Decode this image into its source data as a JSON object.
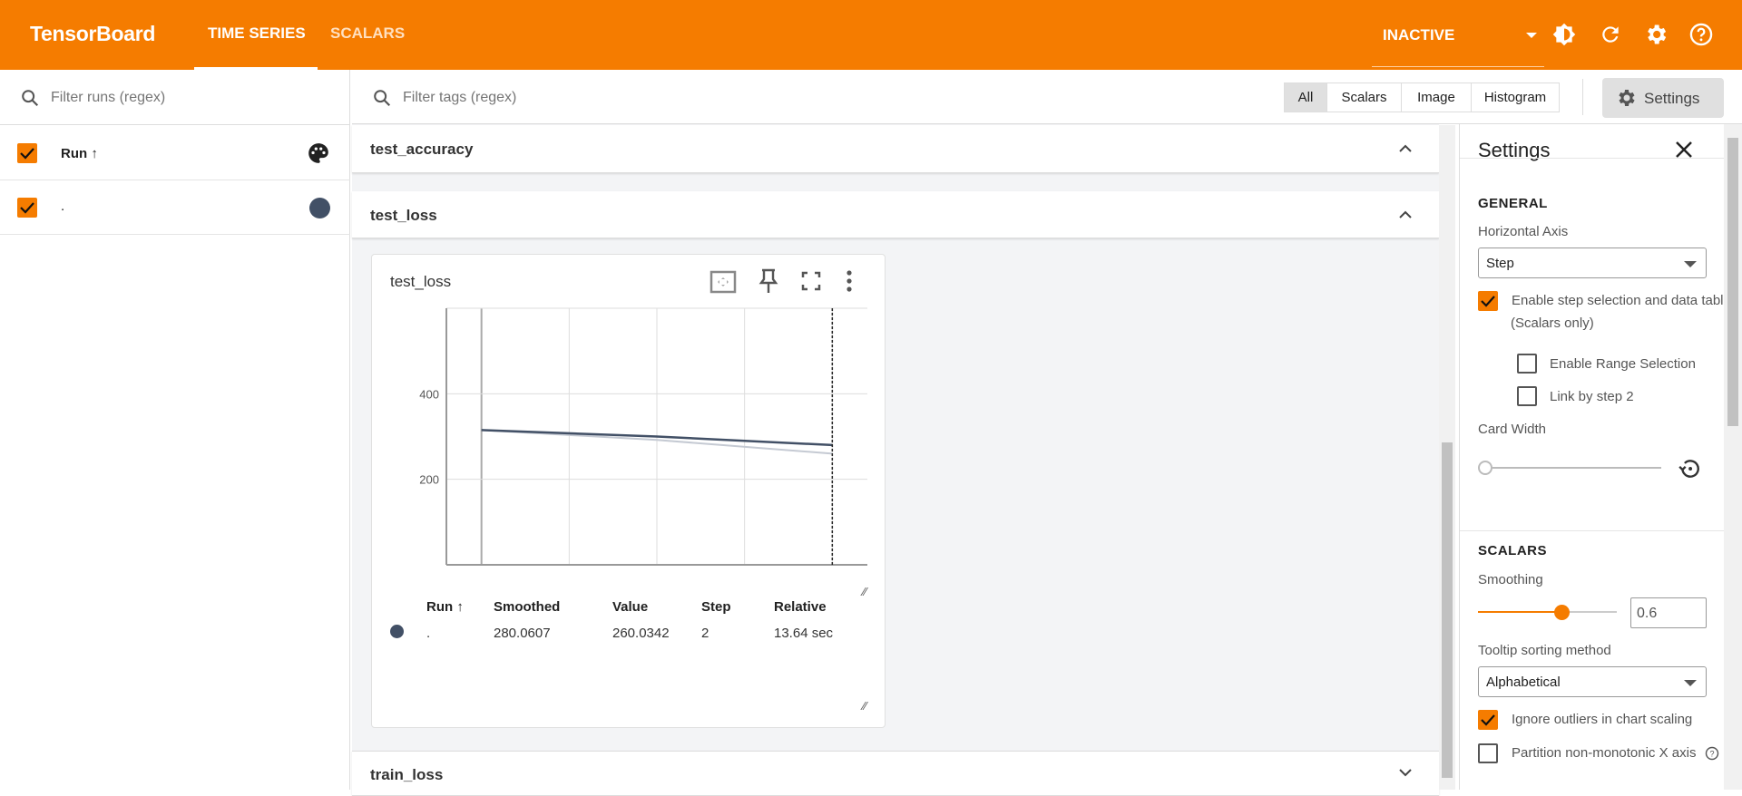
{
  "header": {
    "title": "TensorBoard",
    "tabs": [
      {
        "label": "TIME SERIES",
        "active": true
      },
      {
        "label": "SCALARS",
        "active": false
      }
    ],
    "status": "INACTIVE",
    "icons": [
      "theme-icon",
      "refresh-icon",
      "gear-icon",
      "help-icon"
    ]
  },
  "runs": {
    "filter_placeholder": "Filter runs (regex)",
    "header_label": "Run ↑",
    "items": [
      {
        "name": ".",
        "color": "#425066",
        "checked": true
      }
    ]
  },
  "main": {
    "filter_placeholder": "Filter tags (regex)",
    "types": [
      "All",
      "Scalars",
      "Image",
      "Histogram"
    ],
    "selected_type": "All",
    "settings_label": "Settings",
    "sections": [
      {
        "name": "test_accuracy",
        "expanded": true
      },
      {
        "name": "test_loss",
        "expanded": true
      },
      {
        "name": "train_loss",
        "expanded": false
      }
    ],
    "card": {
      "title": "test_loss",
      "step_chip": "2",
      "table": {
        "headers": [
          "Run ↑",
          "Smoothed",
          "Value",
          "Step",
          "Relative"
        ],
        "rows": [
          {
            "run": ".",
            "smoothed": "280.0607",
            "value": "260.0342",
            "step": "2",
            "relative": "13.64 sec",
            "color": "#425066"
          }
        ]
      }
    }
  },
  "chart_data": {
    "type": "line",
    "xlabel": "",
    "ylabel": "",
    "x_ticks": [
      "0",
      "0.5",
      "1",
      "1.5",
      "2"
    ],
    "y_ticks": [
      "200",
      "400"
    ],
    "xlim": [
      -0.2,
      2.2
    ],
    "ylim": [
      0,
      600
    ],
    "grid": true,
    "series": [
      {
        "role": "smoothed",
        "color": "#425066",
        "x": [
          0,
          1,
          2
        ],
        "y": [
          315,
          300,
          280.0607
        ]
      },
      {
        "role": "raw",
        "color": "#c5cad3",
        "x": [
          0,
          1,
          2
        ],
        "y": [
          315,
          292,
          260.0342
        ]
      }
    ],
    "selected_step": 2
  },
  "settings": {
    "title": "Settings",
    "general": "GENERAL",
    "horizontal_axis_label": "Horizontal Axis",
    "horizontal_axis": "Step",
    "step_selection": "Enable step selection and data table",
    "scalars_only": "(Scalars only)",
    "range_selection": "Enable Range Selection",
    "link_by_step": "Link by step 2",
    "card_width": "Card Width",
    "scalars": "SCALARS",
    "smoothing_label": "Smoothing",
    "smoothing": "0.6",
    "smoothing_value": 0.6,
    "tooltip_label": "Tooltip sorting method",
    "tooltip": "Alphabetical",
    "ignore_outliers": "Ignore outliers in chart scaling",
    "partition": "Partition non-monotonic X axis",
    "accent": "#f57c00"
  }
}
